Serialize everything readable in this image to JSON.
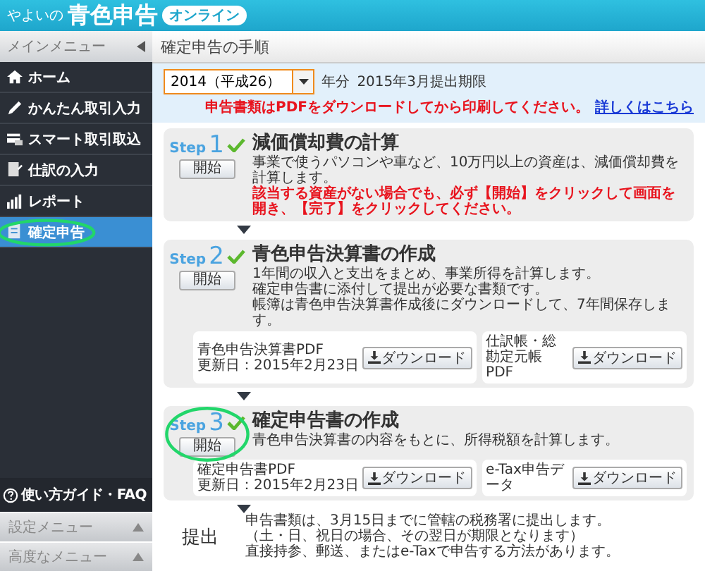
{
  "header": {
    "brand_prefix": "やよいの",
    "brand": "青色申告",
    "badge": "オンライン"
  },
  "sidebar": {
    "title": "メインメニュー",
    "items": [
      {
        "kind": "home",
        "label": "ホーム",
        "selected": false,
        "circled": false
      },
      {
        "kind": "pencil",
        "label": "かんたん取引入力",
        "selected": false,
        "circled": false
      },
      {
        "kind": "card",
        "label": "スマート取引取込",
        "selected": false,
        "circled": false
      },
      {
        "kind": "ledger",
        "label": "仕訳の入力",
        "selected": false,
        "circled": false
      },
      {
        "kind": "chart",
        "label": "レポート",
        "selected": false,
        "circled": false
      },
      {
        "kind": "tax",
        "label": "確定申告",
        "selected": true,
        "circled": true
      }
    ],
    "help": "使い方ガイド・FAQ",
    "menus": [
      {
        "label": "設定メニュー",
        "expanded": false
      },
      {
        "label": "高度なメニュー",
        "expanded": false
      }
    ]
  },
  "page": {
    "title": "確定申告の手順",
    "year_select": "2014（平成26）",
    "year_suffix": "年分",
    "deadline": "2015年3月提出期限",
    "notice": "申告書類はPDFをダウンロードしてから印刷してください。",
    "notice_link": "詳しくはこちら"
  },
  "steps": [
    {
      "step_label": "Step",
      "number": "1",
      "done": true,
      "button": "開始",
      "circled": false,
      "title": "減価償却費の計算",
      "lines": [
        {
          "text": "事業で使うパソコンや車など、10万円以上の資産は、減価償却費を計算します。",
          "warning": false
        },
        {
          "text": "該当する資産がない場合でも、必ず【開始】をクリックして画面を開き、【完了】をクリックしてください。",
          "warning": true
        }
      ]
    },
    {
      "step_label": "Step",
      "number": "2",
      "done": true,
      "button": "開始",
      "circled": false,
      "title": "青色申告決算書の作成",
      "lines": [
        {
          "text": "1年間の収入と支出をまとめ、事業所得を計算します。",
          "warning": false
        },
        {
          "text": "確定申告書に添付して提出が必要な書類です。",
          "warning": false
        },
        {
          "text": "帳簿は青色申告決算書作成後にダウンロードして、7年間保存します。",
          "warning": false
        }
      ],
      "downloads": [
        {
          "label": "青色申告決算書PDF",
          "updated": "更新日：2015年2月23日",
          "button": "ダウンロード"
        },
        {
          "label": "仕訳帳・総勘定元帳PDF",
          "button": "ダウンロード"
        }
      ]
    },
    {
      "step_label": "Step",
      "number": "3",
      "done": true,
      "button": "開始",
      "circled": true,
      "title": "確定申告書の作成",
      "lines": [
        {
          "text": "青色申告決算書の内容をもとに、所得税額を計算します。",
          "warning": false
        }
      ],
      "downloads": [
        {
          "label": "確定申告書PDF",
          "updated": "更新日：2015年2月23日",
          "button": "ダウンロード"
        },
        {
          "label": "e-Tax申告データ",
          "button": "ダウンロード"
        }
      ]
    }
  ],
  "submit": {
    "title": "提出",
    "lines": [
      "申告書類は、3月15日までに管轄の税務署に提出します。",
      "（土・日、祝日の場合、その翌日が期限となります）",
      "直接持参、郵送、またはe-Taxで申告する方法があります。"
    ]
  }
}
